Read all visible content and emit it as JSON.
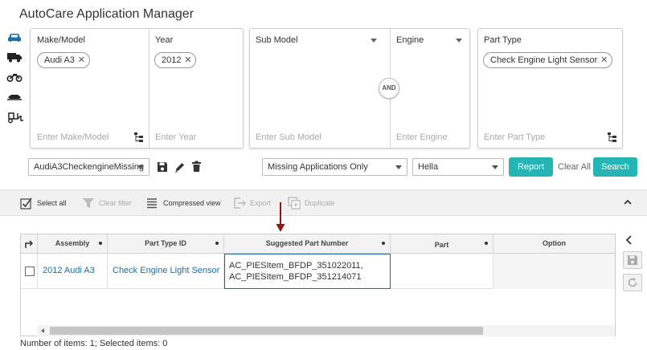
{
  "app": {
    "title": "AutoCare Application Manager"
  },
  "vehicle_nav": [
    {
      "icon": "car-icon"
    },
    {
      "icon": "truck-icon"
    },
    {
      "icon": "motorcycle-icon"
    },
    {
      "icon": "snowmobile-icon"
    },
    {
      "icon": "equipment-icon"
    }
  ],
  "filters": {
    "make_model": {
      "label": "Make/Model",
      "chip": "Audi A3",
      "placeholder": "Enter Make/Model"
    },
    "year": {
      "label": "Year",
      "chip": "2012",
      "placeholder": "Enter Year"
    },
    "sub_model": {
      "label": "Sub Model",
      "placeholder": "Enter Sub Model"
    },
    "engine": {
      "label": "Engine",
      "placeholder": "Enter Engine"
    },
    "and_label": "AND",
    "part_type": {
      "label": "Part Type",
      "chip": "Check Engine Light Sensor",
      "placeholder": "Enter Part Type"
    },
    "chip_remove": "✕"
  },
  "controls": {
    "saved_search": "AudiA3CheckengineMissing",
    "applications_filter": "Missing Applications Only",
    "brand": "Hella",
    "report_label": "Report",
    "clear_all_label": "Clear All",
    "search_label": "Search"
  },
  "toolbar": {
    "select_all": "Select all",
    "clear_filter": "Clear filter",
    "compressed_view": "Compressed view",
    "export": "Export",
    "duplicate": "Duplicate"
  },
  "grid": {
    "columns": [
      "Assembly",
      "Part Type ID",
      "Suggested Part Number",
      "Part",
      "Option"
    ],
    "rows": [
      {
        "assembly": "2012 Audi A3",
        "part_type_id": "Check Engine Light Sensor",
        "suggested_part_number_1": "AC_PIESItem_BFDP_351022011,",
        "suggested_part_number_2": "AC_PIESItem_BFDP_351214071",
        "part": "",
        "option": ""
      }
    ]
  },
  "status": {
    "text": "Number of items: 1; Selected items: 0"
  },
  "colors": {
    "accent": "#26b5b5",
    "link": "#1f6fa8",
    "arrow": "#8b1a1a",
    "nav_active": "#1f6fa8"
  }
}
